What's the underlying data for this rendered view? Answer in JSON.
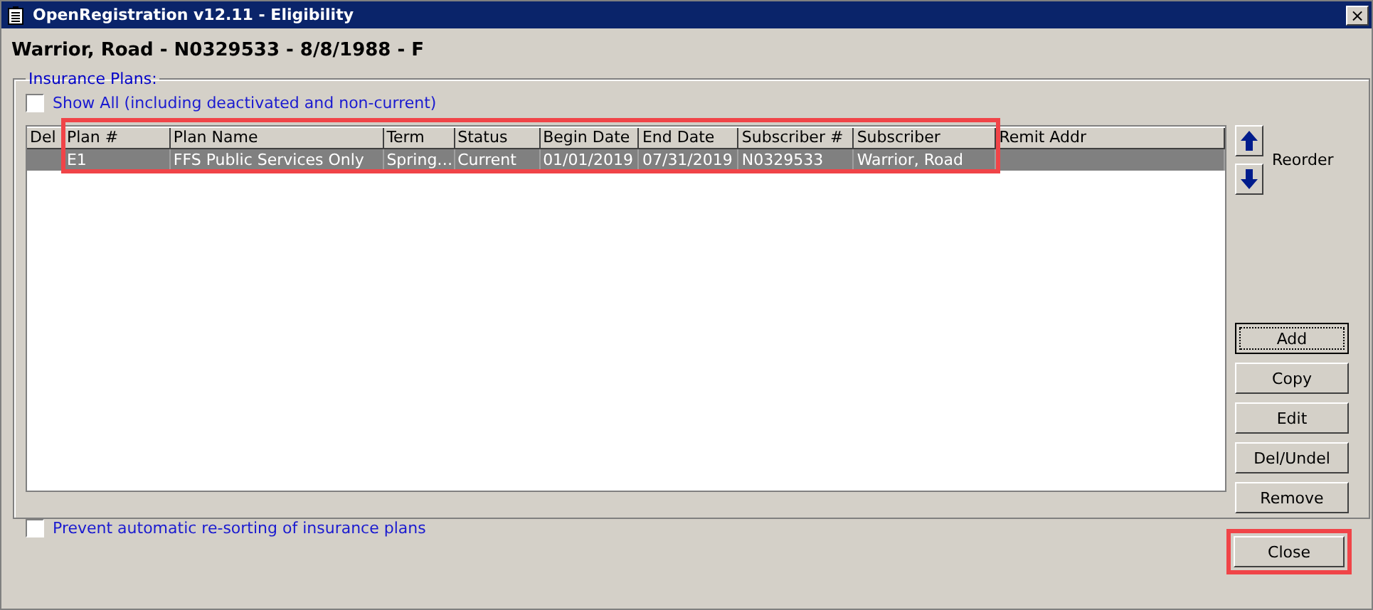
{
  "window": {
    "title": "OpenRegistration v12.11 - Eligibility",
    "close": "×"
  },
  "patient_header": "Warrior, Road - N0329533 - 8/8/1988 - F",
  "group": {
    "title": "Insurance Plans:"
  },
  "show_all": {
    "label": "Show All (including deactivated and non-current)",
    "checked": false
  },
  "table": {
    "columns": [
      "Del",
      "Plan #",
      "Plan Name",
      "Term",
      "Status",
      "Begin Date",
      "End Date",
      "Subscriber #",
      "Subscriber",
      "Remit Addr"
    ],
    "rows": [
      {
        "cells": [
          "",
          "E1",
          "FFS Public Services Only",
          "Spring…",
          "Current",
          "01/01/2019",
          "07/31/2019",
          "N0329533",
          "Warrior, Road",
          ""
        ],
        "selected": true
      }
    ]
  },
  "reorder": {
    "label": "Reorder"
  },
  "buttons": [
    {
      "label": "Add",
      "focused": true
    },
    {
      "label": "Copy",
      "focused": false
    },
    {
      "label": "Edit",
      "focused": false
    },
    {
      "label": "Del/Undel",
      "focused": false
    },
    {
      "label": "Remove",
      "focused": false
    }
  ],
  "prevent_resort": {
    "label": "Prevent automatic re-sorting of insurance plans",
    "checked": false
  },
  "close_button": "Close"
}
